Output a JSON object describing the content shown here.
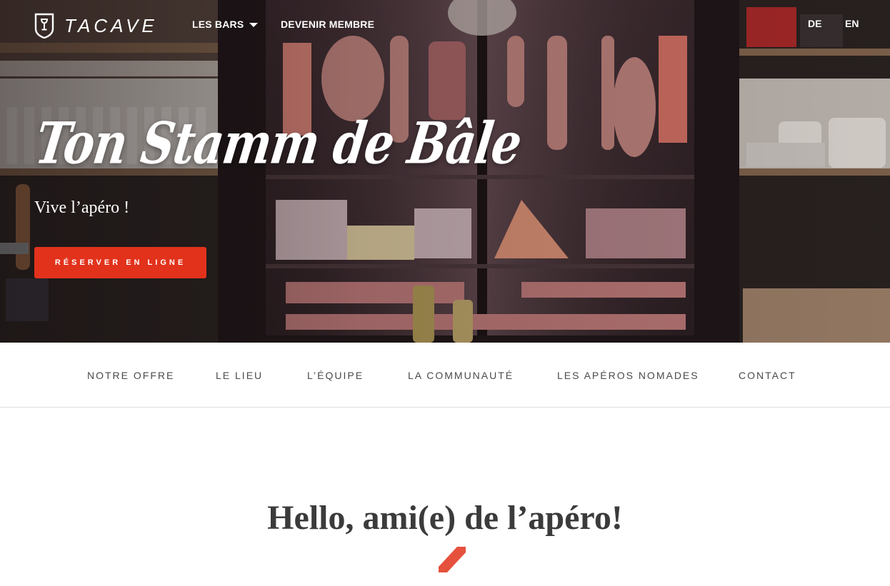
{
  "brand": {
    "name": "TACAVE"
  },
  "topnav": {
    "bars_label": "LES BARS",
    "member_label": "DEVENIR MEMBRE",
    "lang_de": "DE",
    "lang_en": "EN"
  },
  "hero": {
    "title": "Ton Stamm de Bâle",
    "subtitle": "Vive l’apéro !",
    "cta_label": "RÉSERVER EN LIGNE"
  },
  "subnav": {
    "items": [
      "NOTRE OFFRE",
      "LE LIEU",
      "L’ÉQUIPE",
      "LA COMMUNAUTÉ",
      "LES APÉROS NOMADES",
      "CONTACT"
    ]
  },
  "main": {
    "greeting": "Hello, ami(e) de l’apéro!"
  },
  "colors": {
    "accent": "#e2321c",
    "text_dark": "#3b3b3b",
    "nav_text": "#4a4a4a"
  },
  "icons": {
    "logo": "shield-wine-glass-icon",
    "bars_dropdown": "caret-down-icon"
  }
}
